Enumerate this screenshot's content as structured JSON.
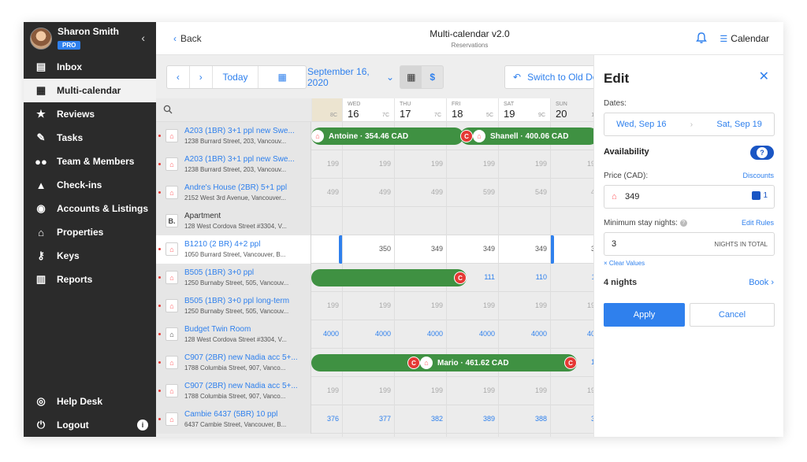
{
  "user": {
    "name": "Sharon Smith",
    "badge": "PRO"
  },
  "nav": [
    {
      "label": "Inbox",
      "icon": "inbox-icon"
    },
    {
      "label": "Multi-calendar",
      "icon": "calendar-icon",
      "active": true
    },
    {
      "label": "Reviews",
      "icon": "star-icon"
    },
    {
      "label": "Tasks",
      "icon": "tasks-icon"
    },
    {
      "label": "Team & Members",
      "icon": "team-icon"
    },
    {
      "label": "Check-ins",
      "icon": "bell-desk-icon"
    },
    {
      "label": "Accounts & Listings",
      "icon": "account-icon"
    },
    {
      "label": "Properties",
      "icon": "home-icon"
    },
    {
      "label": "Keys",
      "icon": "key-icon"
    },
    {
      "label": "Reports",
      "icon": "reports-icon"
    }
  ],
  "nav_bottom": {
    "help": "Help Desk",
    "logout": "Logout",
    "info": "i"
  },
  "header": {
    "back": "Back",
    "title": "Multi-calendar v2.0",
    "subtitle": "Reservations",
    "calendar_link": "Calendar"
  },
  "toolbar": {
    "today": "Today",
    "date": "September 16, 2020",
    "switch": "Switch to Old Design",
    "price_symbol": "$"
  },
  "days": [
    {
      "wd": "",
      "dn": "",
      "tmp": "8C"
    },
    {
      "wd": "WED",
      "dn": "16",
      "tmp": "7C"
    },
    {
      "wd": "THU",
      "dn": "17",
      "tmp": "7C"
    },
    {
      "wd": "FRI",
      "dn": "18",
      "tmp": "5C"
    },
    {
      "wd": "SAT",
      "dn": "19",
      "tmp": "9C"
    },
    {
      "wd": "SUN",
      "dn": "20",
      "tmp": "14"
    }
  ],
  "listings": [
    {
      "name": "A203 (1BR) 3+1 ppl new Swe...",
      "addr": "1238 Burrard Street, 203, Vancouv...",
      "logo": "A",
      "prices": [
        "",
        "",
        "",
        "",
        "",
        ""
      ]
    },
    {
      "name": "A203 (1BR) 3+1 ppl new Swe...",
      "addr": "1238 Burrard Street, 203, Vancouv...",
      "logo": "A",
      "prices": [
        "199",
        "199",
        "199",
        "199",
        "199",
        "199"
      ]
    },
    {
      "name": "Andre's House (2BR) 5+1 ppl",
      "addr": "2152 West 3rd Avenue, Vancouver...",
      "logo": "A",
      "prices": [
        "499",
        "499",
        "499",
        "599",
        "549",
        "49"
      ]
    },
    {
      "name": "Apartment",
      "addr": "128 West Cordova Street #3304, V...",
      "logo": "B.",
      "prices": [
        "",
        "",
        "",
        "",
        "",
        ""
      ]
    },
    {
      "name": "B1210 (2 BR) 4+2 ppl",
      "addr": "1050 Burrard Street, Vancouver, B...",
      "logo": "A",
      "prices": [
        "",
        "350",
        "349",
        "349",
        "349",
        "34"
      ]
    },
    {
      "name": "B505 (1BR) 3+0 ppl",
      "addr": "1250 Burnaby Street, 505, Vancouv...",
      "logo": "A",
      "prices": [
        "",
        "",
        "",
        "111",
        "110",
        "11"
      ]
    },
    {
      "name": "B505 (1BR) 3+0 ppl long-term",
      "addr": "1250 Burnaby Street, 505, Vancouv...",
      "logo": "A",
      "prices": [
        "199",
        "199",
        "199",
        "199",
        "199",
        "199"
      ]
    },
    {
      "name": "Budget Twin Room",
      "addr": "128 West Cordova Street #3304, V...",
      "logo": "H",
      "prices": [
        "4000",
        "4000",
        "4000",
        "4000",
        "4000",
        "400"
      ]
    },
    {
      "name": "C907 (2BR) new Nadia acc 5+...",
      "addr": "1788 Columbia Street, 907, Vanco...",
      "logo": "A",
      "prices": [
        "",
        "",
        "",
        "",
        "",
        "13"
      ]
    },
    {
      "name": "C907 (2BR) new Nadia acc 5+...",
      "addr": "1788 Columbia Street, 907, Vanco...",
      "logo": "A",
      "prices": [
        "199",
        "199",
        "199",
        "199",
        "199",
        "199"
      ]
    },
    {
      "name": "Cambie 6437 (5BR) 10 ppl",
      "addr": "6437 Cambie Street, Vancouver, B...",
      "logo": "A",
      "prices": [
        "376",
        "377",
        "382",
        "389",
        "388",
        "39"
      ]
    }
  ],
  "bookings": {
    "antoine": "Antoine · 354.46 CAD",
    "shanell": "Shanell · 400.06 CAD",
    "mario": "Mario · 461.62 CAD",
    "badge": "C"
  },
  "panel": {
    "title": "Edit",
    "dates_label": "Dates:",
    "date_from": "Wed, Sep 16",
    "date_to": "Sat, Sep 19",
    "availability_label": "Availability",
    "toggle_mark": "?",
    "price_label": "Price (CAD):",
    "discounts": "Discounts",
    "price_value": "349",
    "price_count": "1",
    "minstay_label": "Minimum stay nights:",
    "edit_rules": "Edit Rules",
    "minstay_value": "3",
    "nights_total": "NIGHTS IN TOTAL",
    "clear_values": "× Clear Values",
    "nights": "4 nights",
    "book": "Book",
    "apply": "Apply",
    "cancel": "Cancel"
  },
  "colors": {
    "accent": "#2f80ed",
    "booking": "#3f9142",
    "sidebar": "#2b2b2b",
    "airbnb": "#ff5a5f"
  }
}
